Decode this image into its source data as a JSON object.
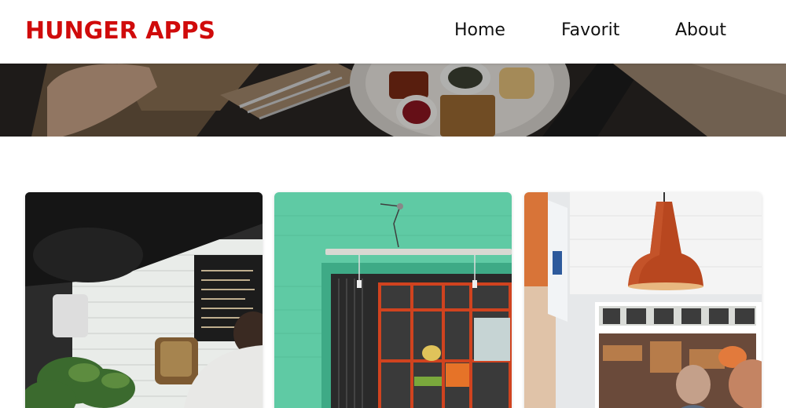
{
  "header": {
    "brand": "HUNGER APPS",
    "nav": [
      {
        "label": "Home"
      },
      {
        "label": "Favorit"
      },
      {
        "label": "About"
      }
    ]
  },
  "colors": {
    "brand": "#d00b0b",
    "nav_text": "#111111",
    "background": "#ffffff"
  },
  "hero": {
    "image": "overhead-breakfast-table-photo"
  },
  "restaurants": [
    {
      "image": "cafe-interior-chalkboard-menu-photo"
    },
    {
      "image": "mint-green-storefront-photo"
    },
    {
      "image": "pendant-lamp-street-view-photo"
    }
  ]
}
